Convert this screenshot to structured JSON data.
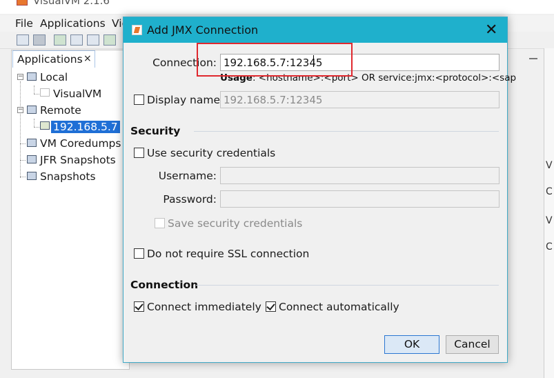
{
  "app": {
    "title": "VisualVM 2.1.6",
    "menu": [
      "File",
      "Applications",
      "Vie"
    ]
  },
  "left_panel": {
    "tab_label": "Applications",
    "tab_close": "×",
    "tree": {
      "local": "Local",
      "visualvm": "VisualVM",
      "remote": "Remote",
      "remote_host": "192.168.5.7",
      "coredumps": "VM Coredumps",
      "jfr": "JFR Snapshots",
      "snapshots": "Snapshots"
    }
  },
  "right_strip": [
    "V",
    "C",
    "V",
    "C"
  ],
  "dialog": {
    "title": "Add JMX Connection",
    "close": "✕",
    "connection_label": "Connection:",
    "connection_value": "192.168.5.7:12345",
    "usage_bold": "Usage",
    "usage_rest": ": <hostname>:<port> OR service:jmx:<protocol>:<sap",
    "display_name_label": "Display name:",
    "display_name_value": "192.168.5.7:12345",
    "security_title": "Security",
    "use_security_label": "Use security credentials",
    "username_label": "Username:",
    "username_value": "",
    "password_label": "Password:",
    "password_value": "",
    "save_credentials_label": "Save security credentials",
    "no_ssl_label": "Do not require SSL connection",
    "connection_title": "Connection",
    "connect_immediately_label": "Connect immediately",
    "connect_automatically_label": "Connect automatically",
    "ok_label": "OK",
    "cancel_label": "Cancel"
  }
}
